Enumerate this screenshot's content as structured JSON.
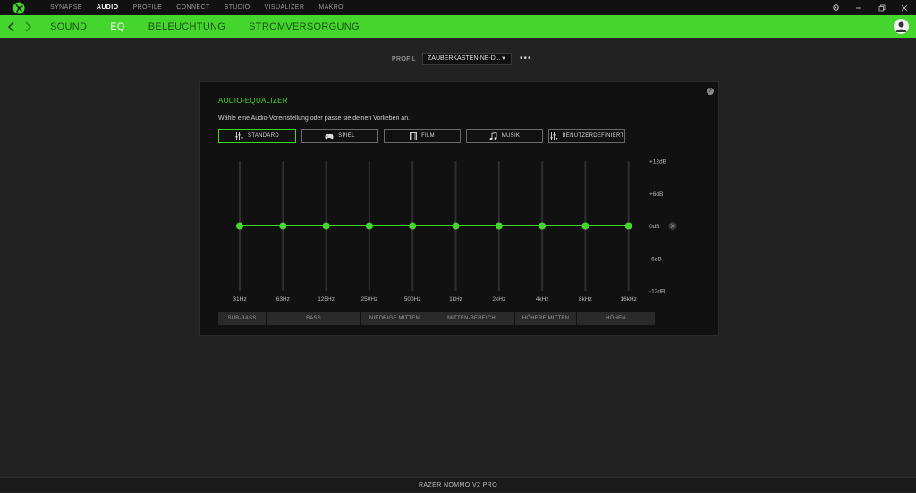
{
  "topnav": {
    "items": [
      {
        "label": "SYNAPSE"
      },
      {
        "label": "AUDIO",
        "active": true
      },
      {
        "label": "PROFILE"
      },
      {
        "label": "CONNECT"
      },
      {
        "label": "STUDIO"
      },
      {
        "label": "VISUALIZER"
      },
      {
        "label": "MAKRO"
      }
    ]
  },
  "subnav": {
    "tabs": [
      {
        "label": "SOUND"
      },
      {
        "label": "EQ",
        "active": true
      },
      {
        "label": "BELEUCHTUNG"
      },
      {
        "label": "STROMVERSORGUNG"
      }
    ]
  },
  "profile": {
    "label": "PROFIL",
    "value": "ZAUBERKASTEN-NE-D...",
    "caret": "▼",
    "more": "•••"
  },
  "equalizer": {
    "title": "AUDIO-EQUALIZER",
    "description": "Wähle eine Audio-Voreinstellung oder passe sie deinen Vorlieben an.",
    "presets": [
      {
        "label": "STANDARD",
        "icon": "sliders-icon",
        "active": true
      },
      {
        "label": "SPIEL",
        "icon": "gamepad-icon"
      },
      {
        "label": "FILM",
        "icon": "film-icon"
      },
      {
        "label": "MUSIK",
        "icon": "music-note-icon"
      },
      {
        "label": "BENUTZERDEFINIERT",
        "icon": "custom-sliders-icon"
      }
    ],
    "frequencies": [
      "31Hz",
      "63Hz",
      "125Hz",
      "250Hz",
      "500Hz",
      "1kHz",
      "2kHz",
      "4kHz",
      "8kHz",
      "16kHz"
    ],
    "gains_db": [
      0,
      0,
      0,
      0,
      0,
      0,
      0,
      0,
      0,
      0
    ],
    "db_labels": [
      "+12dB",
      "+6dB",
      "0dB",
      "-6dB",
      "-12dB"
    ],
    "db_range": [
      -12,
      12
    ],
    "bands": [
      {
        "label": "SUB-BASS"
      },
      {
        "label": "BASS"
      },
      {
        "label": "NIEDRIGE MITTEN"
      },
      {
        "label": "MITTEN-BEREICH"
      },
      {
        "label": "HÖHERE MITTEN"
      },
      {
        "label": "HÖHEN"
      }
    ]
  },
  "footer": {
    "device": "RAZER NOMMO V2 PRO"
  },
  "colors": {
    "accent": "#44d62c",
    "background": "#222222",
    "panel": "#111111"
  }
}
